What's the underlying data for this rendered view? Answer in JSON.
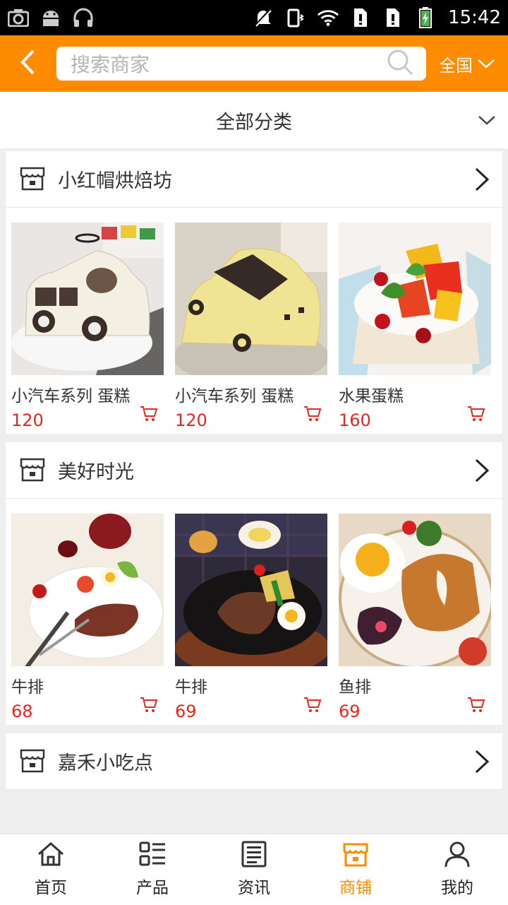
{
  "status_bar": {
    "time": "15:42",
    "icons_left": [
      "screenshot-icon",
      "android-icon",
      "headphones-icon"
    ],
    "icons_right": [
      "mute-icon",
      "vibrate-icon",
      "wifi-icon",
      "sim1-icon",
      "sim2-icon",
      "battery-charging-icon"
    ]
  },
  "header": {
    "back_icon": "chevron-left-icon",
    "search_placeholder": "搜索商家",
    "region_label": "全国",
    "accent_color": "#ff8b00"
  },
  "filter": {
    "label": "全部分类"
  },
  "shops": [
    {
      "name": "小红帽烘焙坊",
      "products": [
        {
          "name": "小汽车系列 蛋糕",
          "price": "120"
        },
        {
          "name": "小汽车系列 蛋糕",
          "price": "120"
        },
        {
          "name": "水果蛋糕",
          "price": "160"
        }
      ]
    },
    {
      "name": "美好时光",
      "products": [
        {
          "name": "牛排",
          "price": "68"
        },
        {
          "name": "牛排",
          "price": "69"
        },
        {
          "name": "鱼排",
          "price": "69"
        }
      ]
    },
    {
      "name": "嘉禾小吃点",
      "products": []
    }
  ],
  "bottom_nav": {
    "active_index": 3,
    "items": [
      {
        "label": "首页",
        "icon": "home-icon"
      },
      {
        "label": "产品",
        "icon": "grid-list-icon"
      },
      {
        "label": "资讯",
        "icon": "news-icon"
      },
      {
        "label": "商铺",
        "icon": "shop-icon"
      },
      {
        "label": "我的",
        "icon": "user-icon"
      }
    ]
  },
  "colors": {
    "price": "#e8261e",
    "accent": "#ff8b00"
  }
}
